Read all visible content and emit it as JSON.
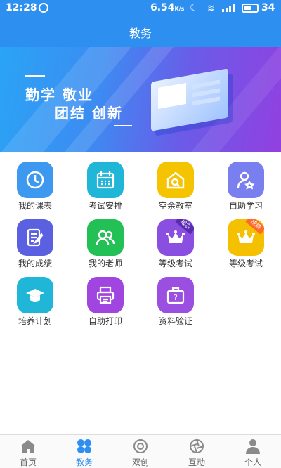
{
  "status": {
    "time": "12:28",
    "speed": "6.54",
    "speed_unit": "K/s",
    "battery": "34"
  },
  "header": {
    "title": "教务"
  },
  "banner": {
    "line1": "勤学 敬业",
    "line2": "团结 创新"
  },
  "grid": [
    {
      "label": "我的课表",
      "icon": "clock-icon",
      "color": "#3d98f0"
    },
    {
      "label": "考试安排",
      "icon": "calendar-icon",
      "color": "#1fb6d8"
    },
    {
      "label": "空余教室",
      "icon": "house-search-icon",
      "color": "#f5c400"
    },
    {
      "label": "自助学习",
      "icon": "person-star-icon",
      "color": "#7a7ff0"
    },
    {
      "label": "我的成绩",
      "icon": "report-edit-icon",
      "color": "#5b60e0"
    },
    {
      "label": "我的老师",
      "icon": "people-icon",
      "color": "#22c055"
    },
    {
      "label": "等级考试",
      "icon": "crown-icon",
      "color": "#8a4fe0",
      "ribbon": "报名",
      "ribbon_color": "#5a2bb0"
    },
    {
      "label": "等级考试",
      "icon": "crown-icon",
      "color": "#f5c000",
      "ribbon": "成绩",
      "ribbon_color": "#ff6a2a"
    },
    {
      "label": "培养计划",
      "icon": "graduation-cap-icon",
      "color": "#1fb6d8"
    },
    {
      "label": "自助打印",
      "icon": "printer-icon",
      "color": "#a145e0"
    },
    {
      "label": "资料验证",
      "icon": "briefcase-icon",
      "color": "#9a4fe0"
    }
  ],
  "tabs": [
    {
      "label": "首页",
      "icon": "home-icon"
    },
    {
      "label": "教务",
      "icon": "clover-icon",
      "active": true
    },
    {
      "label": "双创",
      "icon": "double-circle-icon"
    },
    {
      "label": "互动",
      "icon": "aperture-icon"
    },
    {
      "label": "个人",
      "icon": "person-icon"
    }
  ],
  "colors": {
    "primary": "#2d8ff0"
  }
}
